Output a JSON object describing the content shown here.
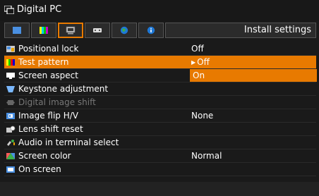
{
  "window": {
    "title": "Digital PC"
  },
  "tabs": [
    {
      "name": "tab-image",
      "icon": "image-adjust-icon"
    },
    {
      "name": "tab-color",
      "icon": "color-bars-icon"
    },
    {
      "name": "tab-install",
      "icon": "projector-install-icon"
    },
    {
      "name": "tab-system",
      "icon": "system-icon"
    },
    {
      "name": "tab-network",
      "icon": "globe-icon"
    },
    {
      "name": "tab-info",
      "icon": "info-icon"
    }
  ],
  "current_tab_label": "Install settings",
  "menu": {
    "items": [
      {
        "label": "Positional lock",
        "value": "Off",
        "icon": "positional-lock-icon"
      },
      {
        "label": "Test pattern",
        "value": "Off",
        "icon": "test-pattern-icon"
      },
      {
        "label": "Screen aspect",
        "value": "On",
        "icon": "screen-aspect-icon"
      },
      {
        "label": "Keystone adjustment",
        "value": "",
        "icon": "keystone-icon"
      },
      {
        "label": "Digital image shift",
        "value": "",
        "icon": "image-shift-icon"
      },
      {
        "label": "Image flip H/V",
        "value": "None",
        "icon": "image-flip-icon"
      },
      {
        "label": "Lens shift reset",
        "value": "",
        "icon": "lens-shift-icon"
      },
      {
        "label": "Audio in terminal select",
        "value": "",
        "icon": "audio-icon"
      },
      {
        "label": "Screen color",
        "value": "Normal",
        "icon": "screen-color-icon"
      },
      {
        "label": "On screen",
        "value": "",
        "icon": "on-screen-icon"
      }
    ]
  },
  "colors": {
    "accent": "#e87a00",
    "background": "#1a1a1a"
  }
}
